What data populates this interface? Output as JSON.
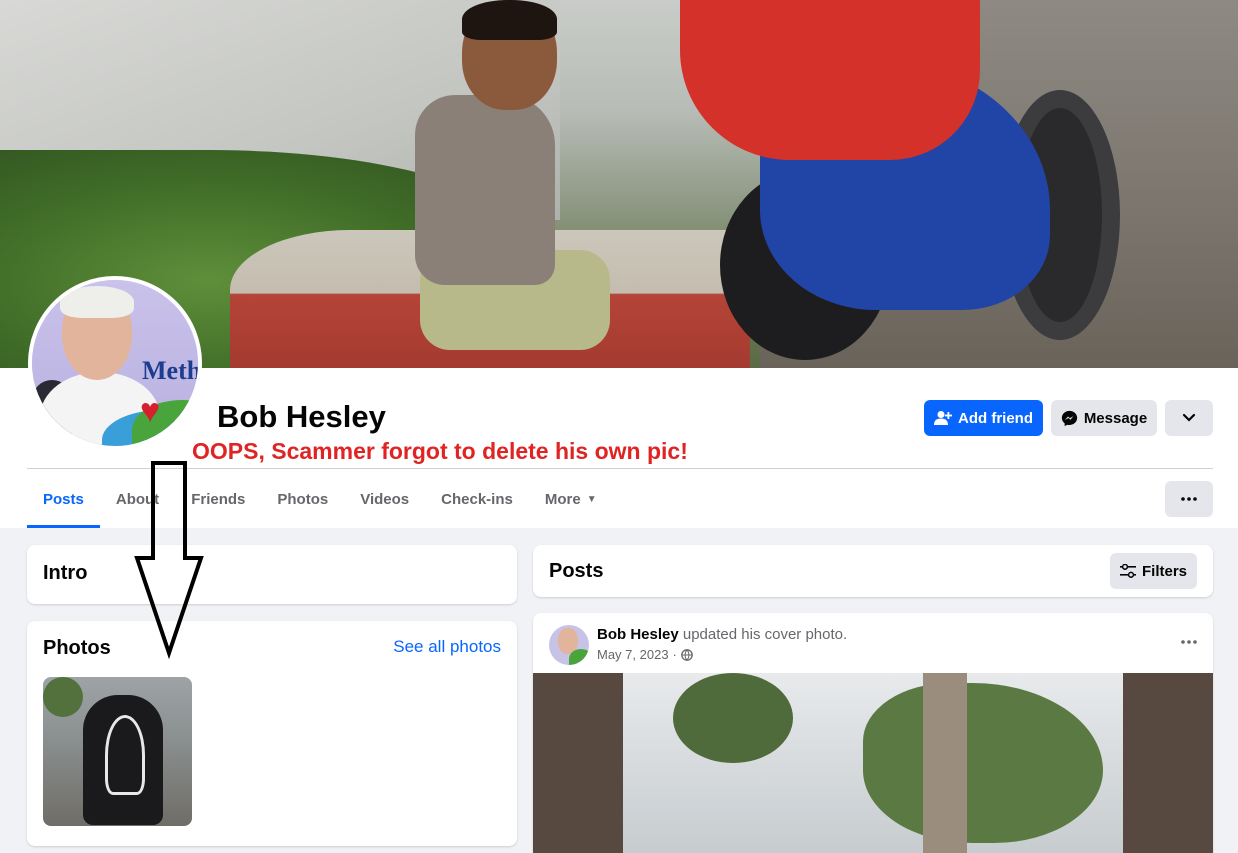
{
  "profile": {
    "name": "Bob Hesley",
    "avatar_brand_text": "Methodist"
  },
  "annotation": "OOPS, Scammer forgot to delete his own pic!",
  "actions": {
    "add_friend": "Add friend",
    "message": "Message",
    "more_icon": "chevron-down-icon"
  },
  "tabs": [
    {
      "label": "Posts",
      "active": true
    },
    {
      "label": "About"
    },
    {
      "label": "Friends"
    },
    {
      "label": "Photos"
    },
    {
      "label": "Videos"
    },
    {
      "label": "Check-ins"
    },
    {
      "label": "More"
    }
  ],
  "intro": {
    "title": "Intro"
  },
  "photos": {
    "title": "Photos",
    "see_all": "See all photos"
  },
  "posts": {
    "title": "Posts",
    "filters": "Filters",
    "items": [
      {
        "author": "Bob Hesley",
        "action": "updated his cover photo.",
        "date": "May 7, 2023",
        "separator": "·",
        "audience_icon": "globe-icon"
      }
    ]
  },
  "colors": {
    "accent": "#0866ff",
    "annotation": "#e02424",
    "background": "#f0f2f5"
  }
}
